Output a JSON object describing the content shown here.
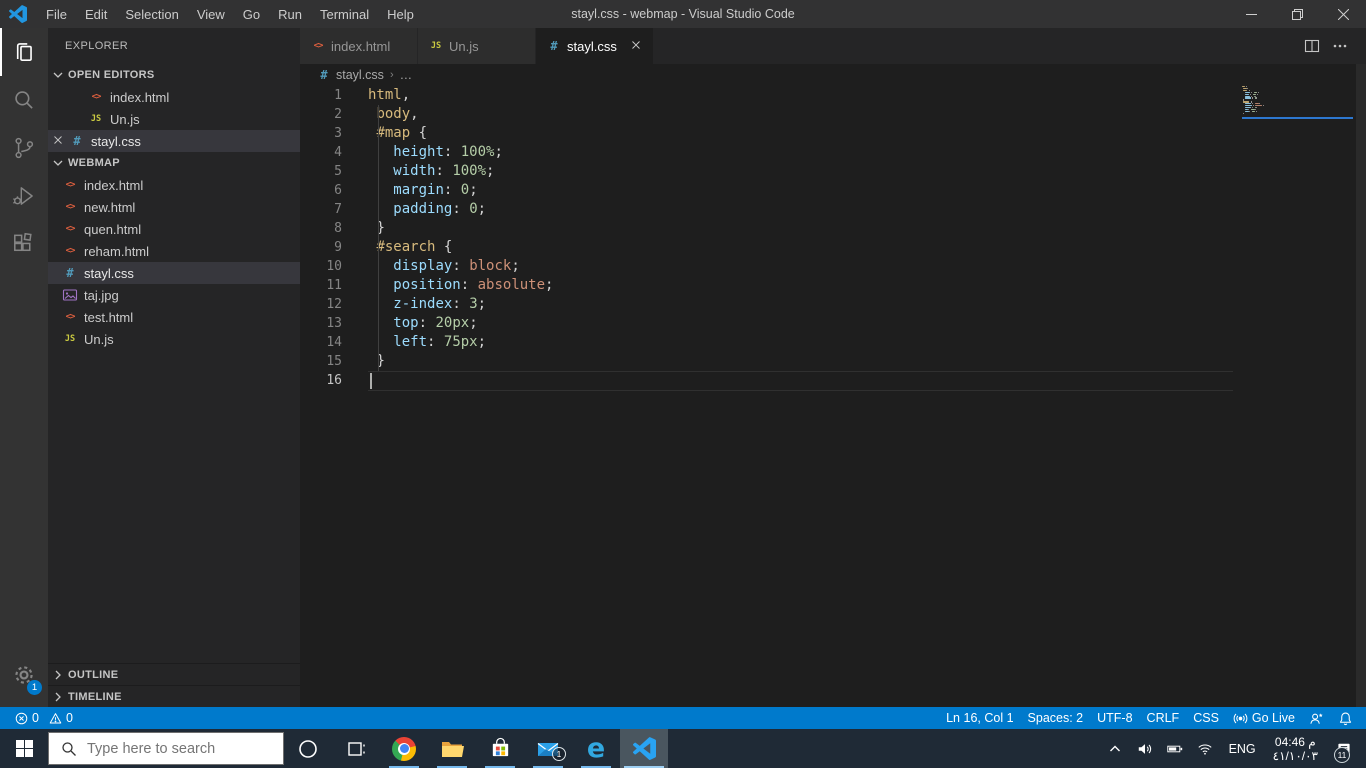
{
  "window": {
    "title": "stayl.css - webmap - Visual Studio Code"
  },
  "menu": [
    "File",
    "Edit",
    "Selection",
    "View",
    "Go",
    "Run",
    "Terminal",
    "Help"
  ],
  "activity_bar": {
    "items": [
      {
        "id": "explorer",
        "icon": "files-icon",
        "active": true
      },
      {
        "id": "search",
        "icon": "search-icon",
        "active": false
      },
      {
        "id": "source-control",
        "icon": "source-control-icon",
        "active": false
      },
      {
        "id": "run-debug",
        "icon": "debug-icon",
        "active": false
      },
      {
        "id": "extensions",
        "icon": "extensions-icon",
        "active": false
      }
    ],
    "settings": {
      "icon": "gear-icon",
      "badge": "1"
    }
  },
  "sidebar": {
    "title": "EXPLORER",
    "open_editors": {
      "label": "OPEN EDITORS",
      "items": [
        {
          "name": "index.html",
          "type": "html",
          "selected": false,
          "close_visible": false
        },
        {
          "name": "Un.js",
          "type": "js",
          "selected": false,
          "close_visible": false
        },
        {
          "name": "stayl.css",
          "type": "css",
          "selected": true,
          "close_visible": true
        }
      ]
    },
    "workspace": {
      "label": "WEBMAP",
      "items": [
        {
          "name": "index.html",
          "type": "html",
          "selected": false
        },
        {
          "name": "new.html",
          "type": "html",
          "selected": false
        },
        {
          "name": "quen.html",
          "type": "html",
          "selected": false
        },
        {
          "name": "reham.html",
          "type": "html",
          "selected": false
        },
        {
          "name": "stayl.css",
          "type": "css",
          "selected": true
        },
        {
          "name": "taj.jpg",
          "type": "image",
          "selected": false
        },
        {
          "name": "test.html",
          "type": "html",
          "selected": false
        },
        {
          "name": "Un.js",
          "type": "js",
          "selected": false
        }
      ]
    },
    "bottom_sections": [
      {
        "label": "OUTLINE"
      },
      {
        "label": "TIMELINE"
      }
    ]
  },
  "editor": {
    "tabs": [
      {
        "label": "index.html",
        "type": "html",
        "active": false
      },
      {
        "label": "Un.js",
        "type": "js",
        "active": false
      },
      {
        "label": "stayl.css",
        "type": "css",
        "active": true
      }
    ],
    "breadcrumb": {
      "file": "stayl.css",
      "separator": "›",
      "ellipsis": "…"
    },
    "cursor": {
      "line": 16,
      "col": 1
    },
    "lines": [
      {
        "n": "1",
        "tokens": [
          [
            "sel",
            "html"
          ],
          [
            "pun",
            ","
          ]
        ]
      },
      {
        "n": "2",
        "tokens": [
          [
            "ws",
            " "
          ],
          [
            "sel",
            "body"
          ],
          [
            "pun",
            ","
          ]
        ]
      },
      {
        "n": "3",
        "tokens": [
          [
            "ws",
            " "
          ],
          [
            "sel",
            "#map"
          ],
          [
            "ws",
            " "
          ],
          [
            "pun",
            "{"
          ]
        ]
      },
      {
        "n": "4",
        "tokens": [
          [
            "ws",
            "   "
          ],
          [
            "prop",
            "height"
          ],
          [
            "pun",
            ":"
          ],
          [
            "ws",
            " "
          ],
          [
            "num",
            "100%"
          ],
          [
            "pun",
            ";"
          ]
        ]
      },
      {
        "n": "5",
        "tokens": [
          [
            "ws",
            "   "
          ],
          [
            "prop",
            "width"
          ],
          [
            "pun",
            ":"
          ],
          [
            "ws",
            " "
          ],
          [
            "num",
            "100%"
          ],
          [
            "pun",
            ";"
          ]
        ]
      },
      {
        "n": "6",
        "tokens": [
          [
            "ws",
            "   "
          ],
          [
            "prop",
            "margin"
          ],
          [
            "pun",
            ":"
          ],
          [
            "ws",
            " "
          ],
          [
            "num",
            "0"
          ],
          [
            "pun",
            ";"
          ]
        ]
      },
      {
        "n": "7",
        "tokens": [
          [
            "ws",
            "   "
          ],
          [
            "prop",
            "padding"
          ],
          [
            "pun",
            ":"
          ],
          [
            "ws",
            " "
          ],
          [
            "num",
            "0"
          ],
          [
            "pun",
            ";"
          ]
        ]
      },
      {
        "n": "8",
        "tokens": [
          [
            "ws",
            " "
          ],
          [
            "pun",
            "}"
          ]
        ]
      },
      {
        "n": "9",
        "tokens": [
          [
            "ws",
            " "
          ],
          [
            "sel",
            "#search"
          ],
          [
            "ws",
            " "
          ],
          [
            "pun",
            "{"
          ]
        ]
      },
      {
        "n": "10",
        "tokens": [
          [
            "ws",
            "   "
          ],
          [
            "prop",
            "display"
          ],
          [
            "pun",
            ":"
          ],
          [
            "ws",
            " "
          ],
          [
            "val",
            "block"
          ],
          [
            "pun",
            ";"
          ]
        ]
      },
      {
        "n": "11",
        "tokens": [
          [
            "ws",
            "   "
          ],
          [
            "prop",
            "position"
          ],
          [
            "pun",
            ":"
          ],
          [
            "ws",
            " "
          ],
          [
            "val",
            "absolute"
          ],
          [
            "pun",
            ";"
          ]
        ]
      },
      {
        "n": "12",
        "tokens": [
          [
            "ws",
            "   "
          ],
          [
            "prop",
            "z-index"
          ],
          [
            "pun",
            ":"
          ],
          [
            "ws",
            " "
          ],
          [
            "num",
            "3"
          ],
          [
            "pun",
            ";"
          ]
        ]
      },
      {
        "n": "13",
        "tokens": [
          [
            "ws",
            "   "
          ],
          [
            "prop",
            "top"
          ],
          [
            "pun",
            ":"
          ],
          [
            "ws",
            " "
          ],
          [
            "num",
            "20px"
          ],
          [
            "pun",
            ";"
          ]
        ]
      },
      {
        "n": "14",
        "tokens": [
          [
            "ws",
            "   "
          ],
          [
            "prop",
            "left"
          ],
          [
            "pun",
            ":"
          ],
          [
            "ws",
            " "
          ],
          [
            "num",
            "75px"
          ],
          [
            "pun",
            ";"
          ]
        ]
      },
      {
        "n": "15",
        "tokens": [
          [
            "ws",
            " "
          ],
          [
            "pun",
            "}"
          ]
        ]
      },
      {
        "n": "16",
        "tokens": []
      }
    ]
  },
  "status_bar": {
    "errors": "0",
    "warnings": "0",
    "cursor_position": "Ln 16, Col 1",
    "indentation": "Spaces: 2",
    "encoding": "UTF-8",
    "eol": "CRLF",
    "language": "CSS",
    "go_live": "Go Live"
  },
  "taskbar": {
    "search_placeholder": "Type here to search",
    "apps": [
      {
        "id": "chrome"
      },
      {
        "id": "file-explorer"
      },
      {
        "id": "store"
      },
      {
        "id": "mail",
        "badge": "1"
      },
      {
        "id": "edge"
      },
      {
        "id": "vscode",
        "active": true
      }
    ],
    "language": "ENG",
    "time": "04:46 م",
    "date": "٤١/١٠/٠٣",
    "action_center_badge": "11"
  },
  "colors": {
    "accent": "#007acc",
    "token_selector": "#d7ba7d",
    "token_property": "#9cdcfe",
    "token_number": "#b5cea8",
    "token_value": "#ce9178"
  }
}
